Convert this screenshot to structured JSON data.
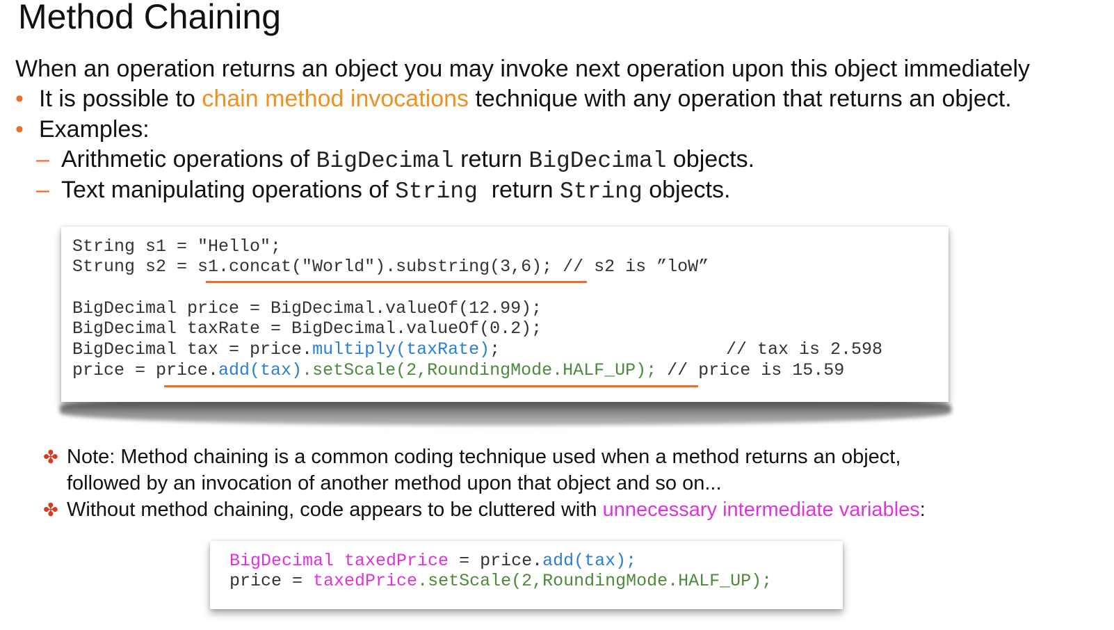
{
  "title": "Method Chaining",
  "intro": "When an operation returns an object you may invoke next operation upon this object immediately",
  "bullets": [
    {
      "pre": "It is possible to ",
      "highlight": "chain method invocations",
      "post": " technique with any operation that returns an object."
    },
    {
      "text": "Examples:"
    }
  ],
  "sub_bullets": [
    {
      "t1": "Arithmetic operations of ",
      "m1": "BigDecimal",
      "t2": " return ",
      "m2": "BigDecimal",
      "t3": " objects."
    },
    {
      "t1": "Text manipulating operations of ",
      "m1": "String ",
      "t2": " return ",
      "m2": "String",
      "t3": " objects."
    }
  ],
  "code1": {
    "l1": "String s1 = \"Hello\";",
    "l2a": "Strung s2 = ",
    "l2b": "s1.concat(\"World\").substring(3,6);",
    "l2c": " // s2 is ”loW”",
    "l3": "BigDecimal price = BigDecimal.valueOf(12.99);",
    "l4": "BigDecimal taxRate = BigDecimal.valueOf(0.2);",
    "l5a": "BigDecimal tax = price.",
    "l5b": "multiply(taxRate)",
    "l5c": ";",
    "l5d": "// tax is 2.598",
    "l6a": "price = price.",
    "l6b": "add(tax)",
    "l6c": ".setScale(2,RoundingMode.HALF_UP);",
    "l6d": " // price is 15.59"
  },
  "notes": [
    {
      "marker": "✤",
      "line1": "Note: Method chaining is a common coding technique used when a method returns an object,",
      "line2": "followed by an invocation of another method upon that object and so on..."
    },
    {
      "marker": "✤",
      "pre": "Without method chaining, code appears to be cluttered with ",
      "highlight": "unnecessary intermediate variables",
      "post": ":"
    }
  ],
  "code2": {
    "l1a": "BigDecimal taxedPrice",
    "l1b": " = price.",
    "l1c": "add(tax);",
    "l2a": "price = ",
    "l2b": "taxedPrice",
    "l2c": ".setScale(2,RoundingMode.HALF_UP);"
  },
  "colors": {
    "bullet_marker": "#e8702a",
    "highlight_orange": "#f0901e",
    "highlight_magenta": "#e032dc",
    "code_blue": "#2a7fd4",
    "code_green": "#4c8a3a",
    "underline": "#e8702a"
  }
}
